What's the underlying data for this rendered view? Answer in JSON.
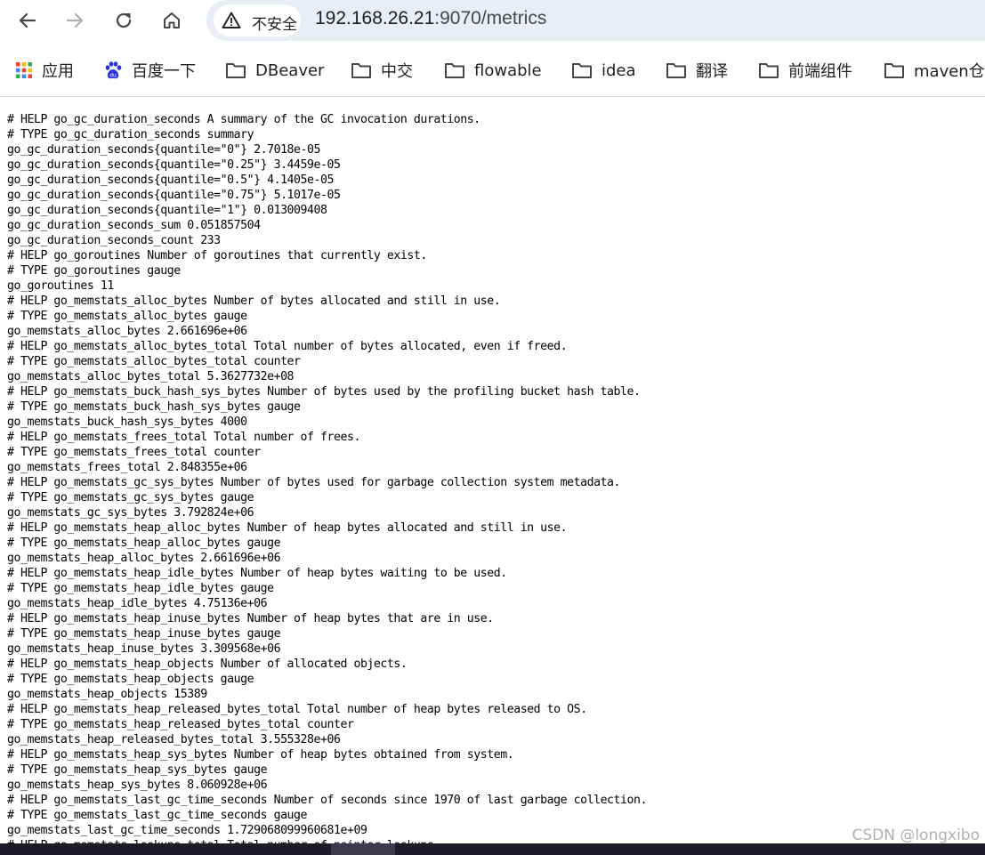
{
  "browser": {
    "security_label": "不安全",
    "url_host": "192.168.26.21",
    "url_path": ":9070/metrics",
    "nav_icons": [
      "back-icon",
      "forward-icon",
      "reload-icon",
      "home-icon",
      "warning-icon"
    ]
  },
  "bookmarks": [
    {
      "label": "应用",
      "icon": "apps-grid-icon"
    },
    {
      "label": "百度一下",
      "icon": "baidu-paw-icon"
    },
    {
      "label": "DBeaver",
      "icon": "folder-icon"
    },
    {
      "label": "中交",
      "icon": "folder-icon"
    },
    {
      "label": "flowable",
      "icon": "folder-icon"
    },
    {
      "label": "idea",
      "icon": "folder-icon"
    },
    {
      "label": "翻译",
      "icon": "folder-icon"
    },
    {
      "label": "前端组件",
      "icon": "folder-icon"
    },
    {
      "label": "maven仓",
      "icon": "folder-icon"
    }
  ],
  "metrics_lines": [
    "# HELP go_gc_duration_seconds A summary of the GC invocation durations.",
    "# TYPE go_gc_duration_seconds summary",
    "go_gc_duration_seconds{quantile=\"0\"} 2.7018e-05",
    "go_gc_duration_seconds{quantile=\"0.25\"} 3.4459e-05",
    "go_gc_duration_seconds{quantile=\"0.5\"} 4.1405e-05",
    "go_gc_duration_seconds{quantile=\"0.75\"} 5.1017e-05",
    "go_gc_duration_seconds{quantile=\"1\"} 0.013009408",
    "go_gc_duration_seconds_sum 0.051857504",
    "go_gc_duration_seconds_count 233",
    "# HELP go_goroutines Number of goroutines that currently exist.",
    "# TYPE go_goroutines gauge",
    "go_goroutines 11",
    "# HELP go_memstats_alloc_bytes Number of bytes allocated and still in use.",
    "# TYPE go_memstats_alloc_bytes gauge",
    "go_memstats_alloc_bytes 2.661696e+06",
    "# HELP go_memstats_alloc_bytes_total Total number of bytes allocated, even if freed.",
    "# TYPE go_memstats_alloc_bytes_total counter",
    "go_memstats_alloc_bytes_total 5.3627732e+08",
    "# HELP go_memstats_buck_hash_sys_bytes Number of bytes used by the profiling bucket hash table.",
    "# TYPE go_memstats_buck_hash_sys_bytes gauge",
    "go_memstats_buck_hash_sys_bytes 4000",
    "# HELP go_memstats_frees_total Total number of frees.",
    "# TYPE go_memstats_frees_total counter",
    "go_memstats_frees_total 2.848355e+06",
    "# HELP go_memstats_gc_sys_bytes Number of bytes used for garbage collection system metadata.",
    "# TYPE go_memstats_gc_sys_bytes gauge",
    "go_memstats_gc_sys_bytes 3.792824e+06",
    "# HELP go_memstats_heap_alloc_bytes Number of heap bytes allocated and still in use.",
    "# TYPE go_memstats_heap_alloc_bytes gauge",
    "go_memstats_heap_alloc_bytes 2.661696e+06",
    "# HELP go_memstats_heap_idle_bytes Number of heap bytes waiting to be used.",
    "# TYPE go_memstats_heap_idle_bytes gauge",
    "go_memstats_heap_idle_bytes 4.75136e+06",
    "# HELP go_memstats_heap_inuse_bytes Number of heap bytes that are in use.",
    "# TYPE go_memstats_heap_inuse_bytes gauge",
    "go_memstats_heap_inuse_bytes 3.309568e+06",
    "# HELP go_memstats_heap_objects Number of allocated objects.",
    "# TYPE go_memstats_heap_objects gauge",
    "go_memstats_heap_objects 15389",
    "# HELP go_memstats_heap_released_bytes_total Total number of heap bytes released to OS.",
    "# TYPE go_memstats_heap_released_bytes_total counter",
    "go_memstats_heap_released_bytes_total 3.555328e+06",
    "# HELP go_memstats_heap_sys_bytes Number of heap bytes obtained from system.",
    "# TYPE go_memstats_heap_sys_bytes gauge",
    "go_memstats_heap_sys_bytes 8.060928e+06",
    "# HELP go_memstats_last_gc_time_seconds Number of seconds since 1970 of last garbage collection.",
    "# TYPE go_memstats_last_gc_time_seconds gauge",
    "go_memstats_last_gc_time_seconds 1.729068099960681e+09",
    "# HELP go_memstats_lookups_total Total number of pointer lookups."
  ],
  "watermark": "CSDN @longxibo",
  "colors": {
    "address_bar_bg": "#e9eef6",
    "folder_icon": "#444746",
    "apps_grid": [
      "#ea4335",
      "#fbbc04",
      "#34a853",
      "#4285f4"
    ],
    "baidu_blue": "#2932e1"
  }
}
